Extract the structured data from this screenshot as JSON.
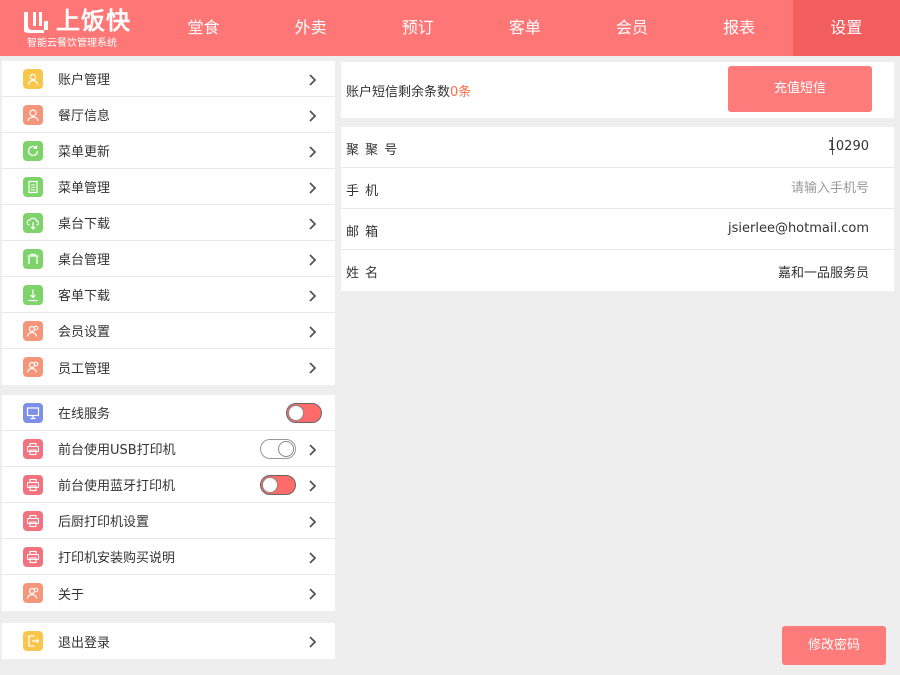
{
  "header": {
    "brand": "上饭快",
    "tagline": "智能云餐饮管理系统",
    "nav": [
      {
        "label": "堂食"
      },
      {
        "label": "外卖"
      },
      {
        "label": "预订"
      },
      {
        "label": "客单"
      },
      {
        "label": "会员"
      },
      {
        "label": "报表"
      },
      {
        "label": "设置",
        "active": true
      }
    ]
  },
  "menu": {
    "group1": [
      {
        "label": "账户管理",
        "icon": "user-icon",
        "color": "#f8c64d"
      },
      {
        "label": "餐厅信息",
        "icon": "restaurant-icon",
        "color": "#f5967a"
      },
      {
        "label": "菜单更新",
        "icon": "refresh-icon",
        "color": "#7ed36b"
      },
      {
        "label": "菜单管理",
        "icon": "document-icon",
        "color": "#7ed36b"
      },
      {
        "label": "桌台下载",
        "icon": "cloud-download-icon",
        "color": "#7ed36b"
      },
      {
        "label": "桌台管理",
        "icon": "table-icon",
        "color": "#7ed36b"
      },
      {
        "label": "客单下载",
        "icon": "download-icon",
        "color": "#7ed36b"
      },
      {
        "label": "会员设置",
        "icon": "members-icon",
        "color": "#f5967a"
      },
      {
        "label": "员工管理",
        "icon": "staff-icon",
        "color": "#f5967a"
      }
    ],
    "group2": [
      {
        "label": "在线服务",
        "icon": "monitor-icon",
        "color": "#7d8fe6",
        "toggle": "on"
      },
      {
        "label": "前台使用USB打印机",
        "icon": "printer-icon",
        "color": "#f2727e",
        "toggle": "off"
      },
      {
        "label": "前台使用蓝牙打印机",
        "icon": "printer-icon",
        "color": "#f2727e",
        "toggle": "on"
      },
      {
        "label": "后厨打印机设置",
        "icon": "printer-icon",
        "color": "#f2727e"
      },
      {
        "label": "打印机安装购买说明",
        "icon": "printer-icon",
        "color": "#f2727e"
      },
      {
        "label": "关于",
        "icon": "info-icon",
        "color": "#f5967a"
      }
    ],
    "group3": [
      {
        "label": "退出登录",
        "icon": "logout-icon",
        "color": "#f8c64d"
      }
    ]
  },
  "sms": {
    "text": "账户短信剩余条数",
    "count": "0条",
    "recharge_label": "充值短信"
  },
  "account": {
    "id_label": "聚 聚 号",
    "id_value": "10290",
    "phone_label": "手 机",
    "phone_placeholder": "请输入手机号",
    "email_label": "邮 箱",
    "email_value": "jsierlee@hotmail.com",
    "name_label": "姓 名",
    "name_value": "嘉和一品服务员"
  },
  "change_password_label": "修改密码",
  "colors": {
    "accent": "#fe7676",
    "active_tab": "#f25d5d",
    "button": "#fe7b7b",
    "count": "#fe6b4a"
  }
}
